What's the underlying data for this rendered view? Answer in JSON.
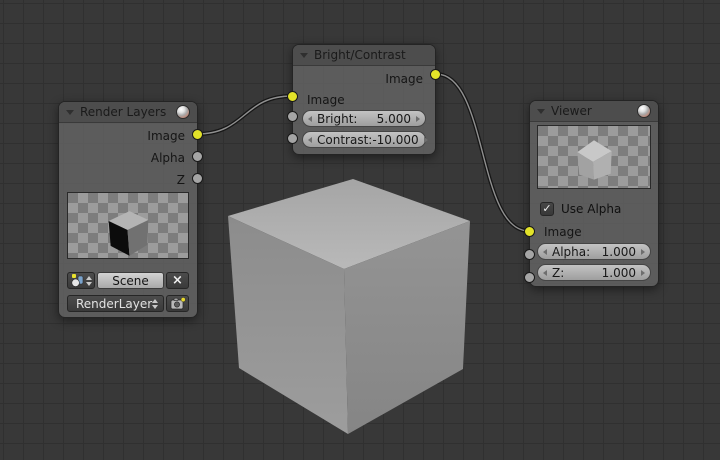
{
  "editor": {
    "background_color": "#383838",
    "grid_line_color": "#303030",
    "grid_size_px": 20
  },
  "colors": {
    "socket_image": "#e3e329",
    "socket_value": "#a5a5a5",
    "node_body": "#636363",
    "node_header": "#4d4d4d",
    "wire_outer": "#161616",
    "wire_inner": "#909090"
  },
  "icons": {
    "collapse": "collapse-triangle",
    "preview_ball": "material-sphere",
    "close": "×",
    "check": "✓"
  },
  "nodes": {
    "render_layers": {
      "title": "Render Layers",
      "outputs": [
        {
          "label": "Image",
          "type": "image"
        },
        {
          "label": "Alpha",
          "type": "value"
        },
        {
          "label": "Z",
          "type": "value"
        }
      ],
      "scene_value": "Scene",
      "layer_value": "RenderLayer"
    },
    "bright_contrast": {
      "title": "Bright/Contrast",
      "output_label": "Image",
      "input_label": "Image",
      "sliders": [
        {
          "label": "Bright:",
          "value": "5.000"
        },
        {
          "label": "Contrast:",
          "value": "-10.000"
        }
      ]
    },
    "viewer": {
      "title": "Viewer",
      "checkbox_label": "Use Alpha",
      "checkbox_checked": true,
      "input_label": "Image",
      "sliders": [
        {
          "label": "Alpha:",
          "value": "1.000"
        },
        {
          "label": "Z:",
          "value": "1.000"
        }
      ]
    }
  }
}
